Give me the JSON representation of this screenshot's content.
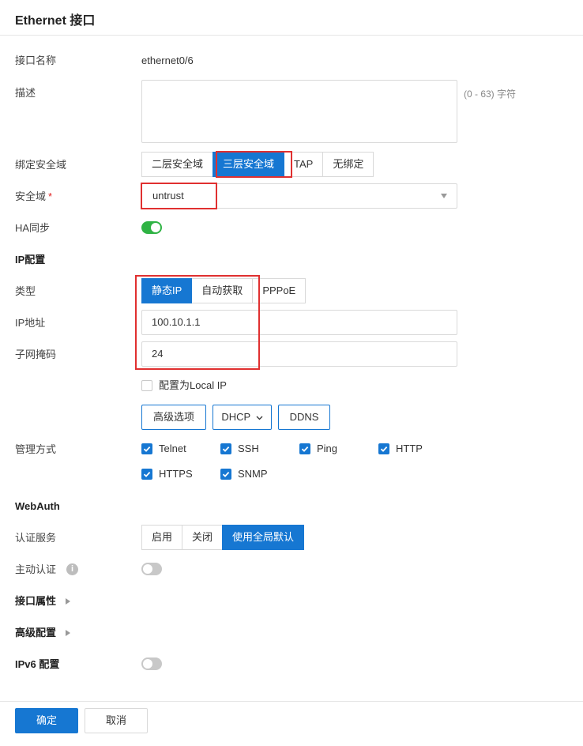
{
  "header": {
    "title": "Ethernet 接口"
  },
  "form": {
    "interface_name": {
      "label": "接口名称",
      "value": "ethernet0/6"
    },
    "description": {
      "label": "描述",
      "value": "",
      "hint": "(0 - 63) 字符"
    },
    "bind_zone": {
      "label": "绑定安全域",
      "options": [
        "二层安全域",
        "三层安全域",
        "TAP",
        "无绑定"
      ],
      "selected": "三层安全域"
    },
    "zone": {
      "label": "安全域",
      "required_mark": "*",
      "value": "untrust"
    },
    "ha_sync": {
      "label": "HA同步",
      "enabled": true
    }
  },
  "ip_config": {
    "section_title": "IP配置",
    "type": {
      "label": "类型",
      "options": [
        "静态IP",
        "自动获取",
        "PPPoE"
      ],
      "selected": "静态IP"
    },
    "ip_address": {
      "label": "IP地址",
      "value": "100.10.1.1"
    },
    "netmask": {
      "label": "子网掩码",
      "value": "24"
    },
    "local_ip": {
      "label": "配置为Local IP",
      "checked": false
    },
    "buttons": {
      "advanced": "高级选项",
      "dhcp": "DHCP",
      "ddns": "DDNS"
    }
  },
  "management": {
    "label": "管理方式",
    "options": [
      {
        "label": "Telnet",
        "checked": true
      },
      {
        "label": "SSH",
        "checked": true
      },
      {
        "label": "Ping",
        "checked": true
      },
      {
        "label": "HTTP",
        "checked": true
      },
      {
        "label": "HTTPS",
        "checked": true
      },
      {
        "label": "SNMP",
        "checked": true
      }
    ]
  },
  "webauth": {
    "section_title": "WebAuth",
    "auth_service": {
      "label": "认证服务",
      "options": [
        "启用",
        "关闭",
        "使用全局默认"
      ],
      "selected": "使用全局默认"
    },
    "active_auth": {
      "label": "主动认证",
      "enabled": false,
      "info_icon": "i"
    }
  },
  "sections": {
    "interface_props": "接口属性",
    "advanced_config": "高级配置",
    "ipv6": {
      "label": "IPv6 配置",
      "enabled": false
    }
  },
  "footer": {
    "ok": "确定",
    "cancel": "取消"
  },
  "colors": {
    "primary": "#1677d2",
    "toggle_on": "#2fb344",
    "highlight": "#e03030"
  }
}
